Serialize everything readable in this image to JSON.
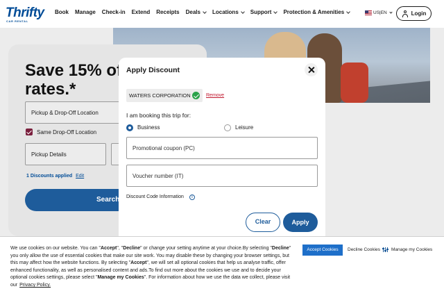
{
  "header": {
    "logo_text": "Thrifty",
    "logo_sub": "CAR RENTAL",
    "nav": [
      {
        "label": "Book",
        "dropdown": false
      },
      {
        "label": "Manage",
        "dropdown": false
      },
      {
        "label": "Check-in",
        "dropdown": false
      },
      {
        "label": "Extend",
        "dropdown": false
      },
      {
        "label": "Receipts",
        "dropdown": false
      },
      {
        "label": "Deals",
        "dropdown": true
      },
      {
        "label": "Locations",
        "dropdown": true
      },
      {
        "label": "Support",
        "dropdown": true
      },
      {
        "label": "Protection & Amenities",
        "dropdown": true
      }
    ],
    "language": "US|EN",
    "login_label": "Login"
  },
  "background": {
    "headline": "Save 15% off rates.*",
    "pickup_dropoff_placeholder": "Pickup & Drop-Off Location",
    "same_dropoff_label": "Same Drop-Off Location",
    "pickup_details_label": "Pickup Details",
    "discounts_applied": "1 Discounts applied",
    "edit_label": "Edit",
    "search_label": "Search"
  },
  "modal": {
    "title": "Apply Discount",
    "corporation": "WATERS CORPORATION",
    "remove_label": "Remove",
    "booking_prompt": "I am booking this trip for:",
    "options": [
      {
        "label": "Business",
        "selected": true
      },
      {
        "label": "Leisure",
        "selected": false
      }
    ],
    "promo_placeholder": "Promotional coupon (PC)",
    "voucher_placeholder": "Voucher number (IT)",
    "info_label": "Discount Code Information",
    "clear_label": "Clear",
    "apply_label": "Apply"
  },
  "cookie": {
    "t1": "We use cookies on our website. You can \"",
    "accept_word": "Accept",
    "t2": "\", \"",
    "decline_word": "Decline",
    "t3": "\" or change your setting anytime at your choice.By selecting \"",
    "t4": "\" you only allow the use of essential cookies that make our site work. You may disable these by changing your browser settings, but this may affect how the website functions. By selecting \"",
    "t5": "\", we will set all optional cookies that help us analyse traffic, offer enhanced functionality, as well as personalised content and ads.To find out more about the cookies we use and to decide your optional cookies settings, please select \"",
    "manage_word": "Manage my Cookies",
    "t6": "\". For information about how we use the data we collect, please visit our",
    "privacy_label": "Privacy Policy.",
    "accept_button": "Accept Cookies",
    "decline_button": "Decline Cookies",
    "manage_button": "Manage my Cookies"
  },
  "colors": {
    "brand_blue": "#1e5c9b",
    "accept_blue": "#1e6fc9",
    "checkbox": "#7a1f3d",
    "success": "#2aa24a",
    "remove_red": "#c0172e"
  }
}
